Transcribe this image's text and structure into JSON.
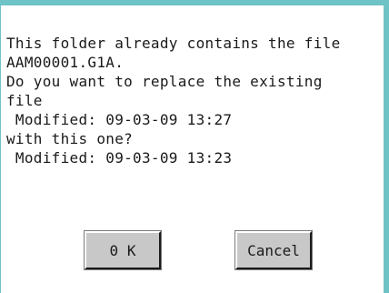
{
  "dialog": {
    "message_lines": [
      "This folder already contains the file",
      "AAM00001.G1A.",
      "Do you want to replace the existing",
      "file",
      " Modified: 09-03-09 13:27",
      "with this one?",
      " Modified: 09-03-09 13:23"
    ],
    "ok_label": "0 K",
    "cancel_label": "Cancel"
  }
}
